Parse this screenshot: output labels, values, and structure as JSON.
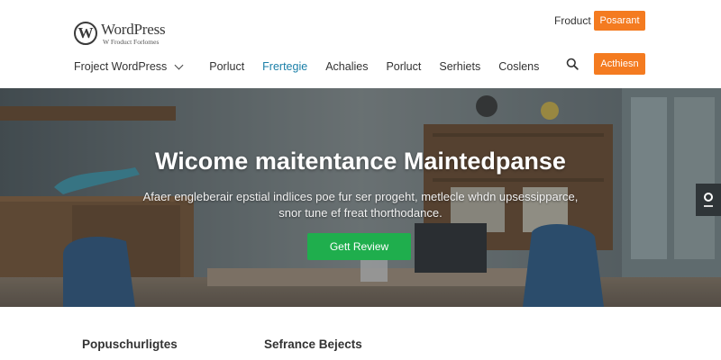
{
  "header": {
    "logo": {
      "name": "WordPress",
      "tagline": "W Froduct Forlomes"
    },
    "top_link": "Froduct",
    "top_button": "Posarant",
    "nav": [
      {
        "label": "Froject WordPress",
        "has_dropdown": true,
        "active": false
      },
      {
        "label": "Porluct",
        "has_dropdown": false,
        "active": false
      },
      {
        "label": "Frertegie",
        "has_dropdown": false,
        "active": true
      },
      {
        "label": "Achalies",
        "has_dropdown": false,
        "active": false
      },
      {
        "label": "Porluct",
        "has_dropdown": false,
        "active": false
      },
      {
        "label": "Serhiets",
        "has_dropdown": false,
        "active": false
      },
      {
        "label": "Coslens",
        "has_dropdown": false,
        "active": false
      }
    ],
    "action_button": "Acthiesn",
    "search_icon": "search-icon"
  },
  "hero": {
    "title": "Wicome maitentance Maintedpanse",
    "subtitle": "Afaer engleberair epstial indlices poe fur ser progeht, metlecle whdn upsessipparce, snor tune ef freat thorthodance.",
    "cta": "Gett Review"
  },
  "lower": {
    "col1": "Popuschurligtes",
    "col2": "Sefrance Bejects"
  },
  "colors": {
    "accent_orange": "#f47b20",
    "cta_green": "#1fae4d",
    "active_nav": "#1a7fa8"
  }
}
